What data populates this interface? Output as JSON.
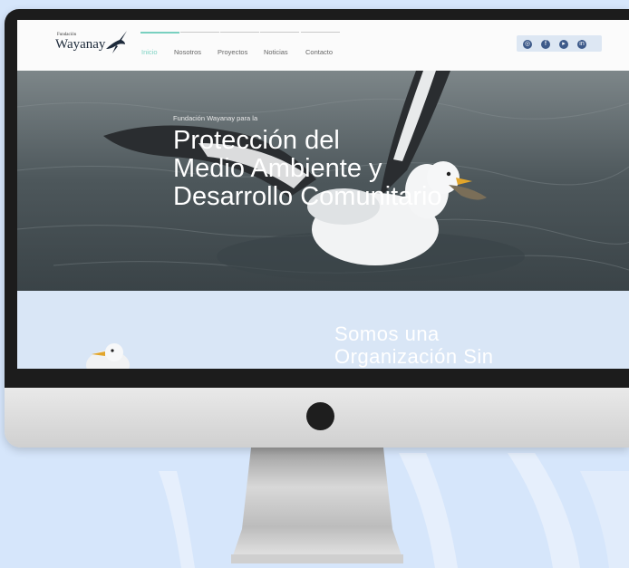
{
  "colors": {
    "page_background": "#d6e6fb",
    "nav_active": "#7fd3c4",
    "social_icons": "#3d5a8a",
    "lower_section": "#d9e6f6"
  },
  "logo": {
    "small_text": "Fundación",
    "name": "Wayanay",
    "icon": "swallow-bird-icon"
  },
  "nav": {
    "items": [
      {
        "label": "Inicio",
        "active": true
      },
      {
        "label": "Nosotros",
        "active": false
      },
      {
        "label": "Proyectos",
        "active": false
      },
      {
        "label": "Noticias",
        "active": false
      },
      {
        "label": "Contacto",
        "active": false
      }
    ]
  },
  "social": {
    "icons": [
      "instagram-icon",
      "facebook-icon",
      "youtube-icon",
      "linkedin-icon"
    ]
  },
  "hero": {
    "pretitle": "Fundación Wayanay para la",
    "title_lines": [
      "Protección del",
      "Medio Ambiente y",
      "Desarrollo Comunitario"
    ],
    "image": "seagull-in-water-photo"
  },
  "section": {
    "title_lines": [
      "Somos una",
      "Organización Sin"
    ]
  }
}
